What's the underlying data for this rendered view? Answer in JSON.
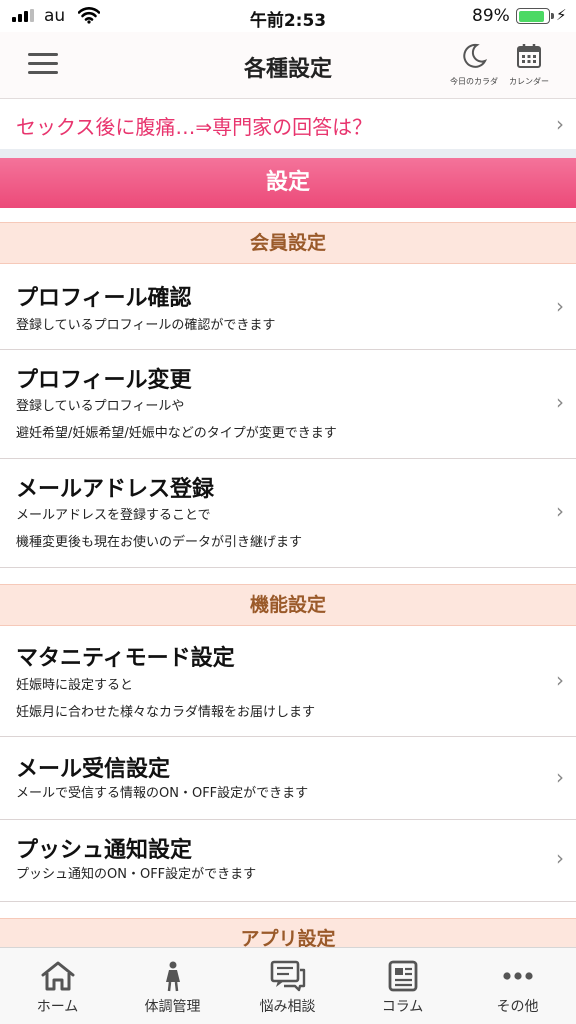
{
  "status_bar": {
    "carrier": "au",
    "time": "午前2:53",
    "battery_percent": "89%",
    "battery_level": 0.89
  },
  "header": {
    "title": "各種設定",
    "today_label": "今日のカラダ",
    "calendar_label": "カレンダー",
    "menu_icon": "hamburger-menu-icon"
  },
  "banner": {
    "text": "セックス後に腹痛…⇒専門家の回答は？"
  },
  "section": {
    "title": "設定"
  },
  "member_group": {
    "title": "会員設定",
    "items": [
      {
        "title": "プロフィール確認",
        "lines": [
          "登録しているプロフィールの確認ができます"
        ]
      },
      {
        "title": "プロフィール変更",
        "lines": [
          "登録しているプロフィールや",
          "避妊希望/妊娠希望/妊娠中などのタイプが変更できます"
        ]
      },
      {
        "title": "メールアドレス登録",
        "lines": [
          "メールアドレスを登録することで",
          "機種変更後も現在お使いのデータが引き継げます"
        ]
      }
    ]
  },
  "function_group": {
    "title": "機能設定",
    "items": [
      {
        "title": "マタニティモード設定",
        "lines": [
          "妊娠時に設定すると",
          "妊娠月に合わせた様々なカラダ情報をお届けします"
        ]
      },
      {
        "title": "メール受信設定",
        "lines": [
          "メールで受信する情報のON・OFF設定ができます"
        ]
      },
      {
        "title": "プッシュ通知設定",
        "lines": [
          "プッシュ通知のON・OFF設定ができます"
        ]
      }
    ]
  },
  "app_group": {
    "title": "アプリ設定"
  },
  "tabbar": {
    "items": [
      {
        "label": "ホーム",
        "icon": "home-icon"
      },
      {
        "label": "体調管理",
        "icon": "woman-figure-icon"
      },
      {
        "label": "悩み相談",
        "icon": "chat-bubbles-icon"
      },
      {
        "label": "コラム",
        "icon": "article-icon"
      },
      {
        "label": "その他",
        "icon": "more-dots-icon"
      }
    ]
  },
  "colors": {
    "accent_pink": "#ec4a79",
    "group_bg": "#fde6dd",
    "group_text": "#9a5a2a",
    "banner_text": "#e8356e"
  }
}
